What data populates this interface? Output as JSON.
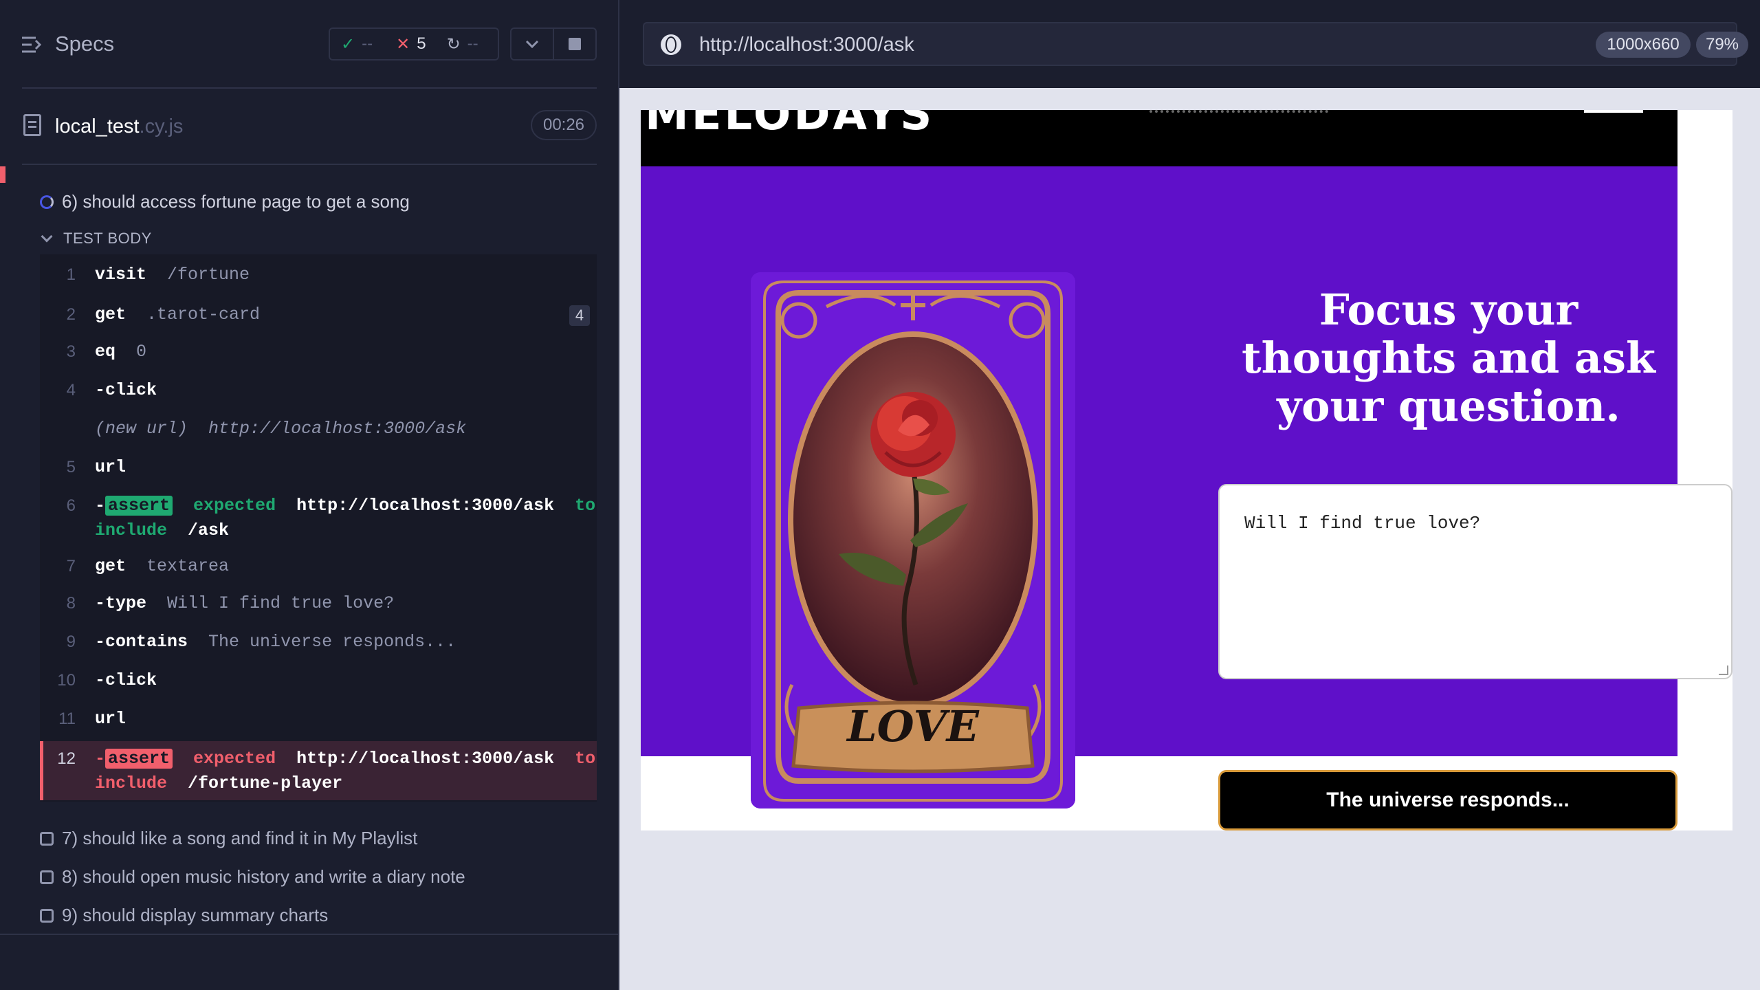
{
  "reporter": {
    "title": "Specs",
    "stats": {
      "passed": "--",
      "failed": "5",
      "pending": "--"
    },
    "file": {
      "name": "local_test",
      "ext": ".cy.js",
      "duration": "00:26"
    },
    "current_test": "6) should access fortune page to get a song",
    "body_label": "TEST BODY",
    "commands": [
      {
        "num": "1",
        "name": "visit",
        "arg": "/fortune"
      },
      {
        "num": "2",
        "name": "get",
        "arg": ".tarot-card",
        "count": "4"
      },
      {
        "num": "3",
        "name": "eq",
        "arg": "0"
      },
      {
        "num": "4",
        "name": "-click",
        "arg": ""
      },
      {
        "num": "",
        "name": "(new url)",
        "arg": "http://localhost:3000/ask"
      },
      {
        "num": "5",
        "name": "url",
        "arg": ""
      },
      {
        "num": "6",
        "prefix": "-",
        "badge": "assert",
        "w1": "expected",
        "v1": "http://localhost:3000/ask",
        "w2": "to",
        "w3": "include",
        "v2": "/ask"
      },
      {
        "num": "7",
        "name": "get",
        "arg": "textarea"
      },
      {
        "num": "8",
        "name": "-type",
        "arg": "Will I find true love?"
      },
      {
        "num": "9",
        "name": "-contains",
        "arg": "The universe responds..."
      },
      {
        "num": "10",
        "name": "-click",
        "arg": ""
      },
      {
        "num": "11",
        "name": "url",
        "arg": ""
      },
      {
        "num": "12",
        "prefix": "-",
        "badge": "assert",
        "w1": "expected",
        "v1": "http://localhost:3000/ask",
        "w2": "to",
        "w3": "include",
        "v2": "/fortune-player"
      }
    ],
    "pending_tests": [
      "7) should like a song and find it in My Playlist",
      "8) should open music history and write a diary note",
      "9) should display summary charts"
    ]
  },
  "aut": {
    "url": "http://localhost:3000/ask",
    "viewport": "1000x660",
    "zoom": "79%",
    "site": {
      "logo": "MELODAYS",
      "card_label": "LOVE",
      "heading": "Focus your thoughts and ask your question.",
      "question_value": "Will I find true love?",
      "button_label": "The universe responds..."
    }
  },
  "colors": {
    "hero_purple": "#5f10c9",
    "pass_green": "#1fa971",
    "fail_red": "#f15f6c",
    "panel_bg": "#1b1e2e"
  }
}
